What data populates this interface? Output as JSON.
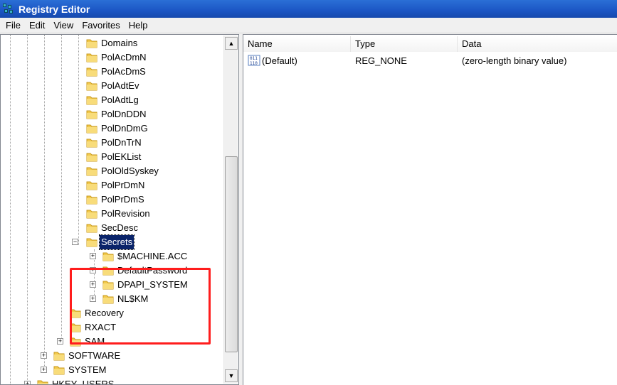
{
  "window": {
    "title": "Registry Editor"
  },
  "menu": [
    "File",
    "Edit",
    "View",
    "Favorites",
    "Help"
  ],
  "tree": {
    "policy_children": [
      "Domains",
      "PolAcDmN",
      "PolAcDmS",
      "PolAdtEv",
      "PolAdtLg",
      "PolDnDDN",
      "PolDnDmG",
      "PolDnTrN",
      "PolEKList",
      "PolOldSyskey",
      "PolPrDmN",
      "PolPrDmS",
      "PolRevision",
      "SecDesc"
    ],
    "secrets": {
      "label": "Secrets",
      "expander": "−",
      "children": [
        "$MACHINE.ACC",
        "DefaultPassword",
        "DPAPI_SYSTEM",
        "NL$KM"
      ]
    },
    "security_children": [
      "Recovery",
      "RXACT",
      "SAM"
    ],
    "root_children": [
      "SOFTWARE",
      "SYSTEM"
    ],
    "partial_next": "HKEY_USERS",
    "expander_plus": "+"
  },
  "list": {
    "columns": [
      "Name",
      "Type",
      "Data"
    ],
    "rows": [
      {
        "name": "(Default)",
        "type": "REG_NONE",
        "data": "(zero-length binary value)"
      }
    ]
  },
  "colors": {
    "highlight_box": "#ff1d1d",
    "selection": "#0a246a",
    "titlebar": "#1c56c4"
  },
  "icons": {
    "app": "registry-editor-icon",
    "folder": "folder-icon",
    "value": "binary-value-icon",
    "scroll_up": "scroll-up-arrow-icon",
    "scroll_down": "scroll-down-arrow-icon"
  }
}
